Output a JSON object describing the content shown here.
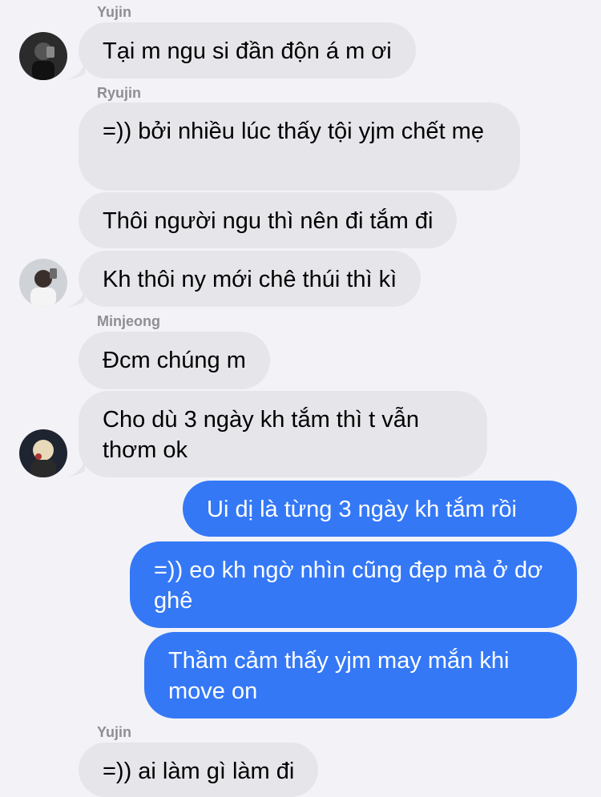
{
  "conversation": [
    {
      "sender": "Yujin",
      "text": "Tại m ngu si đần độn á m ơi"
    },
    {
      "sender": "Ryujin",
      "text": "=)) bởi nhiều lúc thấy tội yjm chết mẹ"
    },
    {
      "text": "Thôi người ngu thì nên đi tắm đi"
    },
    {
      "text": "Kh thôi ny mới chê thúi thì kì"
    },
    {
      "sender": "Minjeong",
      "text": "Đcm chúng m"
    },
    {
      "text": "Cho dù 3 ngày kh tắm thì t vẫn thơm ok"
    },
    {
      "text": "Ui dị là từng 3 ngày kh tắm rồi"
    },
    {
      "text": "=)) eo kh ngờ nhìn cũng đẹp mà ở dơ ghê"
    },
    {
      "text": "Thầm cảm thấy yjm may mắn khi move on"
    },
    {
      "sender": "Yujin",
      "text": "=)) ai làm gì làm đi"
    }
  ],
  "avatars": {
    "yujin": "yujin-avatar",
    "ryujin": "ryujin-avatar",
    "minjeong": "minjeong-avatar"
  },
  "colors": {
    "background": "#f2f2f7",
    "incoming_bubble": "#e5e5ea",
    "outgoing_bubble": "#3478f6",
    "sender_name": "#8e8e93"
  }
}
